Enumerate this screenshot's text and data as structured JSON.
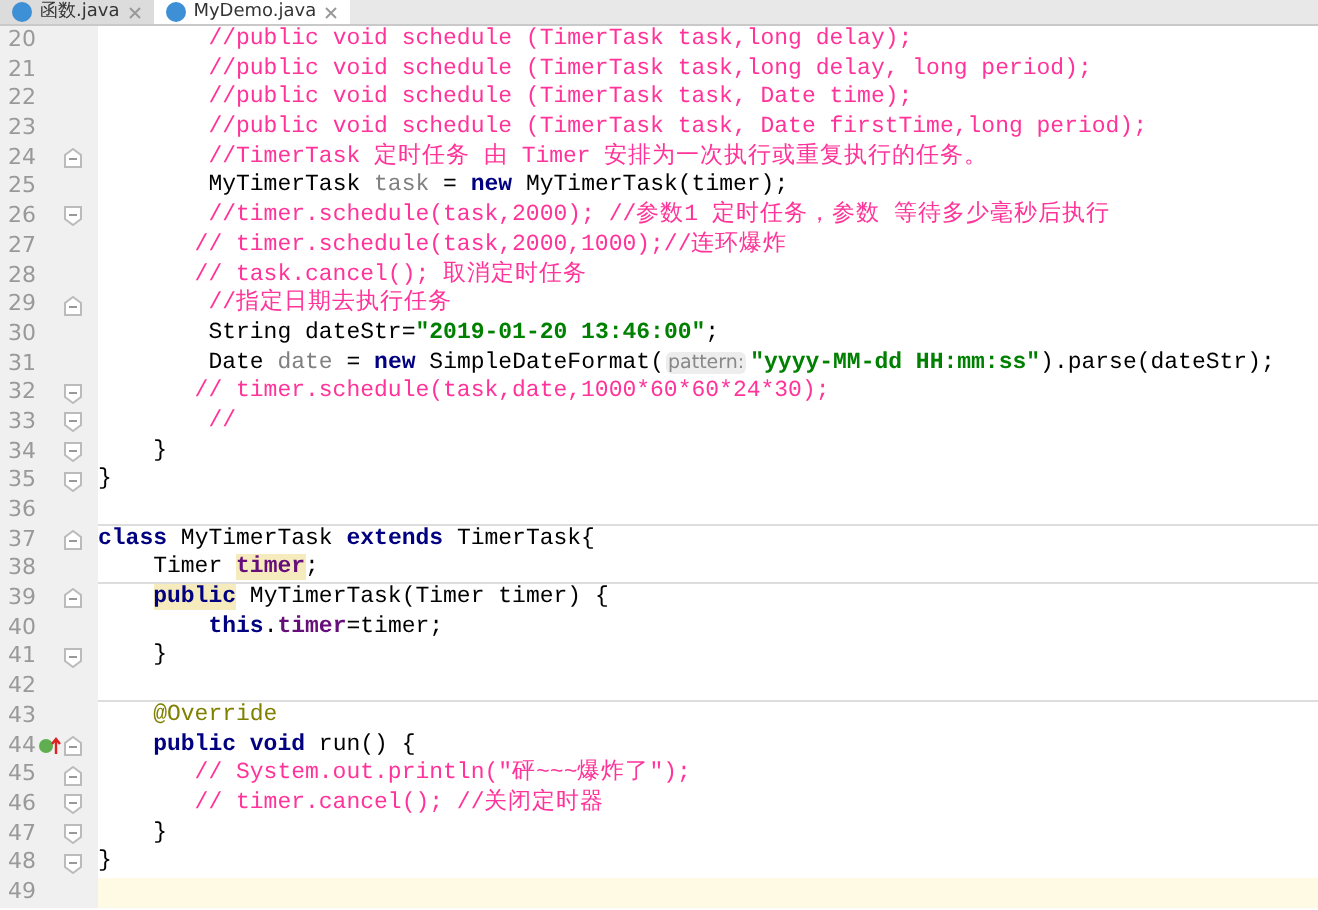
{
  "tabs": [
    {
      "label": "函数.java",
      "selected": false
    },
    {
      "label": "MyDemo.java",
      "selected": true
    }
  ],
  "lines": [
    {
      "children": [
        {
          "children": [
            {
              "number": "20",
              "tokens": [
                {
                  "kind": "comment",
                  "text": "//public void schedule (TimerTask task,long delay);"
                }
              ]
            },
            {
              "number": "21",
              "tokens": [
                {
                  "kind": "comment",
                  "text": "//public void schedule (TimerTask task,long delay, long period);"
                }
              ]
            },
            {
              "number": "22",
              "tokens": [
                {
                  "kind": "comment",
                  "text": "//public void schedule (TimerTask task, Date time);"
                }
              ]
            },
            {
              "number": "23",
              "tokens": [
                {
                  "kind": "comment",
                  "text": "//public void schedule (TimerTask task, Date firstTime,long period);"
                }
              ]
            },
            {
              "number": "24",
              "fold_start": true,
              "tokens": [
                {
                  "kind": "comment",
                  "text": "//TimerTask 定时任务 由 Timer 安排为一次执行或重复执行的任务。"
                }
              ]
            },
            {
              "number": "25",
              "tokens": [
                {
                  "kind": "plain",
                  "text": "MyTimerTask "
                },
                {
                  "kind": "unused",
                  "text": "task"
                },
                {
                  "kind": "plain",
                  "text": " = "
                },
                {
                  "kind": "keyword",
                  "text": "new"
                },
                {
                  "kind": "plain",
                  "text": " MyTimerTask(timer);"
                }
              ]
            },
            {
              "number": "26",
              "fold_end": true,
              "tokens": [
                {
                  "kind": "comment",
                  "text": "//timer.schedule(task,2000); //参数1 定时任务，参数 等待多少毫秒后执行"
                }
              ]
            },
            {
              "number": "27",
              "line_comment": true,
              "tokens": [
                {
                  "kind": "comment",
                  "text": "// timer.schedule(task,2000,1000);//连环爆炸"
                }
              ]
            },
            {
              "number": "28",
              "line_comment": true,
              "tokens": [
                {
                  "kind": "comment",
                  "text": "// task.cancel(); 取消定时任务"
                }
              ]
            },
            {
              "number": "29",
              "fold_start": true,
              "tokens": [
                {
                  "kind": "comment",
                  "text": "//指定日期去执行任务"
                }
              ]
            },
            {
              "number": "30",
              "tokens": [
                {
                  "kind": "plain",
                  "text": "String dateStr="
                },
                {
                  "kind": "string",
                  "text": "\"2019-01-20 13:46:00\""
                },
                {
                  "kind": "plain",
                  "text": ";"
                }
              ]
            },
            {
              "number": "31",
              "tokens": [
                {
                  "kind": "plain",
                  "text": "Date "
                },
                {
                  "kind": "unused",
                  "text": "date"
                },
                {
                  "kind": "plain",
                  "text": " = "
                },
                {
                  "kind": "keyword",
                  "text": "new"
                },
                {
                  "kind": "plain",
                  "text": " SimpleDateFormat("
                },
                {
                  "kind": "hint",
                  "text": "pattern:"
                },
                {
                  "kind": "string",
                  "text": "\"yyyy-MM-dd HH:mm:ss\""
                },
                {
                  "kind": "plain",
                  "text": ").parse(dateStr);"
                }
              ]
            },
            {
              "number": "32",
              "fold_end": true,
              "line_comment": true,
              "tokens": [
                {
                  "kind": "comment",
                  "text": "// timer.schedule(task,date,1000*60*60*24*30);"
                }
              ]
            },
            {
              "number": "33",
              "fold_end": true,
              "tokens": [
                {
                  "kind": "comment",
                  "text": "//"
                }
              ]
            }
          ]
        },
        {
          "number": "34",
          "fold_end": true,
          "tokens": [
            {
              "kind": "plain",
              "text": "}"
            }
          ]
        }
      ]
    },
    {
      "number": "35",
      "fold_end": true,
      "tokens": [
        {
          "kind": "plain",
          "text": "}"
        }
      ]
    },
    {
      "number": "36"
    },
    {
      "number": "37",
      "fold_start": true,
      "separator": true,
      "tokens": [
        {
          "kind": "keyword",
          "text": "class"
        },
        {
          "kind": "plain",
          "text": " MyTimerTask "
        },
        {
          "kind": "keyword",
          "text": "extends"
        },
        {
          "kind": "plain",
          "text": " TimerTask{"
        }
      ],
      "children": [
        {
          "number": "38",
          "tokens": [
            {
              "kind": "plain",
              "text": "Timer "
            },
            {
              "kind": "field",
              "text": "timer",
              "highlight": true
            },
            {
              "kind": "plain",
              "text": ";"
            }
          ]
        },
        {
          "number": "39",
          "fold_start": true,
          "separator": true,
          "tokens": [
            {
              "kind": "keyword",
              "text": "public",
              "highlight": true
            },
            {
              "kind": "plain",
              "text": " MyTimerTask(Timer timer) {"
            }
          ],
          "children": [
            {
              "number": "40",
              "tokens": [
                {
                  "kind": "keyword",
                  "text": "this"
                },
                {
                  "kind": "plain",
                  "text": "."
                },
                {
                  "kind": "field",
                  "text": "timer"
                },
                {
                  "kind": "plain",
                  "text": "=timer;"
                }
              ]
            }
          ]
        },
        {
          "number": "41",
          "fold_end": true,
          "tokens": [
            {
              "kind": "plain",
              "text": "}"
            }
          ]
        },
        {
          "number": "42"
        },
        {
          "number": "43",
          "separator": true,
          "tokens": [
            {
              "kind": "annotation",
              "text": "@Override"
            }
          ]
        },
        {
          "number": "44",
          "fold_start": true,
          "overrides": true,
          "tokens": [
            {
              "kind": "keyword",
              "text": "public void"
            },
            {
              "kind": "plain",
              "text": " run() {"
            }
          ],
          "children": [
            {
              "number": "45",
              "fold_start": true,
              "line_comment": true,
              "tokens": [
                {
                  "kind": "comment",
                  "text": "// System.out.println(\"砰~~~爆炸了\");"
                }
              ]
            },
            {
              "number": "46",
              "fold_end": true,
              "line_comment": true,
              "tokens": [
                {
                  "kind": "comment",
                  "text": "// timer.cancel(); //关闭定时器"
                }
              ]
            }
          ]
        },
        {
          "number": "47",
          "fold_end": true,
          "tokens": [
            {
              "kind": "plain",
              "text": "}"
            }
          ]
        }
      ]
    },
    {
      "number": "48",
      "fold_end": true,
      "tokens": [
        {
          "kind": "plain",
          "text": "}"
        }
      ]
    },
    {
      "number": "49",
      "current": true
    }
  ]
}
